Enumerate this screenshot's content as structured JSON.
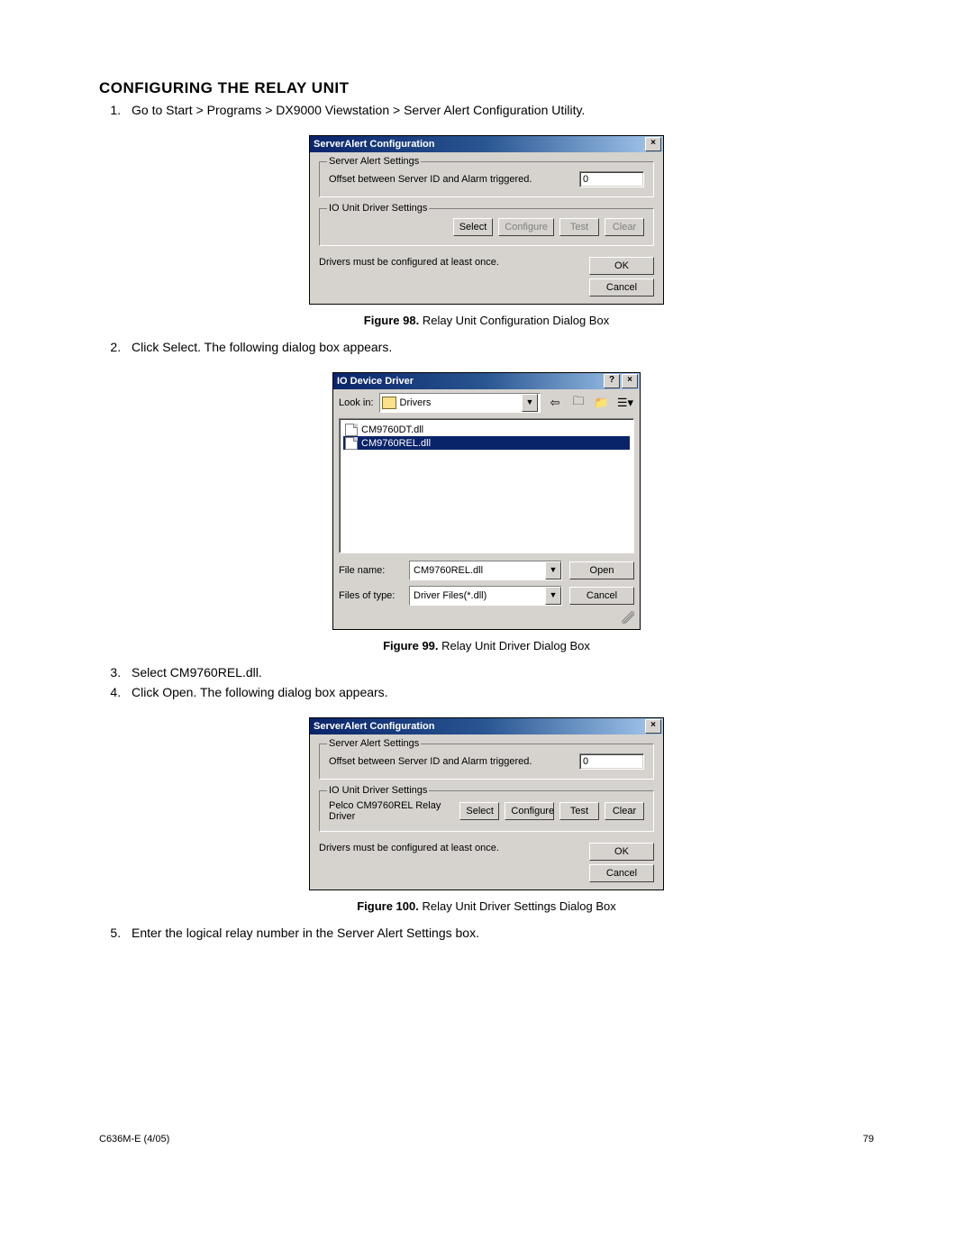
{
  "section_title": "CONFIGURING THE RELAY UNIT",
  "steps": {
    "s1": "Go to Start > Programs > DX9000 Viewstation > Server Alert Configuration Utility.",
    "s2": "Click Select. The following dialog box appears.",
    "s3": "Select CM9760REL.dll.",
    "s4": "Click Open. The following dialog box appears.",
    "s5": "Enter the logical relay number in the Server Alert Settings box."
  },
  "fig98": {
    "label": "Figure 98.",
    "caption": "Relay Unit Configuration Dialog Box",
    "dialog": {
      "title": "ServerAlert Configuration",
      "group1_legend": "Server Alert Settings",
      "offset_label": "Offset between Server ID and Alarm triggered.",
      "offset_value": "0",
      "group2_legend": "IO Unit Driver Settings",
      "driver_name": "",
      "btn_select": "Select",
      "btn_configure": "Configure",
      "btn_test": "Test",
      "btn_clear": "Clear",
      "status": "Drivers must be configured at least once.",
      "btn_ok": "OK",
      "btn_cancel": "Cancel"
    }
  },
  "fig99": {
    "label": "Figure 99.",
    "caption": "Relay Unit Driver Dialog Box",
    "dialog": {
      "title": "IO Device Driver",
      "lookin_label": "Look in:",
      "lookin_value": "Drivers",
      "file1": "CM9760DT.dll",
      "file2": "CM9760REL.dll",
      "filename_label": "File name:",
      "filename_value": "CM9760REL.dll",
      "filetype_label": "Files of type:",
      "filetype_value": "Driver Files(*.dll)",
      "btn_open": "Open",
      "btn_cancel": "Cancel"
    }
  },
  "fig100": {
    "label": "Figure 100.",
    "caption": "Relay Unit Driver Settings Dialog Box",
    "dialog": {
      "title": "ServerAlert Configuration",
      "group1_legend": "Server Alert Settings",
      "offset_label": "Offset between Server ID and Alarm triggered.",
      "offset_value": "0",
      "group2_legend": "IO Unit Driver Settings",
      "driver_name": "Pelco CM9760REL Relay Driver",
      "btn_select": "Select",
      "btn_configure": "Configure",
      "btn_test": "Test",
      "btn_clear": "Clear",
      "status": "Drivers must be configured at least once.",
      "btn_ok": "OK",
      "btn_cancel": "Cancel"
    }
  },
  "footer_left": "C636M-E (4/05)",
  "footer_right": "79"
}
